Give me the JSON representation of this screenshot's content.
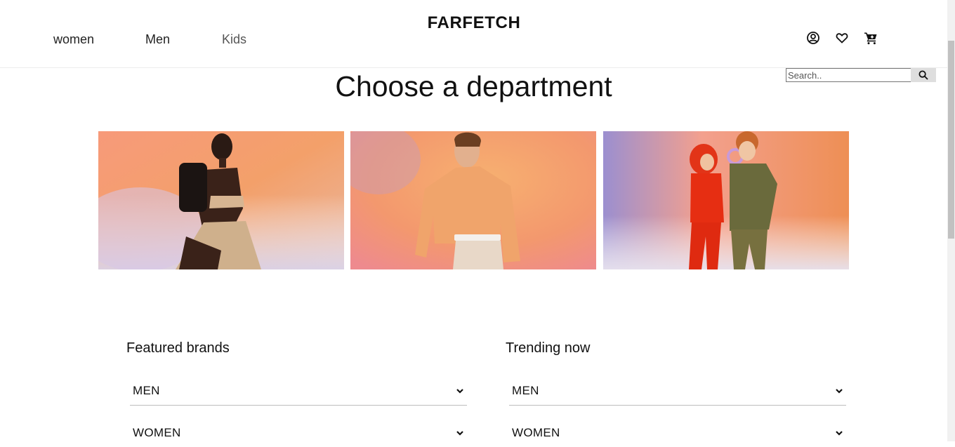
{
  "header": {
    "logo": "FARFETCH",
    "nav": [
      {
        "label": "women"
      },
      {
        "label": "Men"
      },
      {
        "label": "Kids"
      }
    ],
    "icons": [
      "account-icon",
      "heart-icon",
      "cart-icon"
    ]
  },
  "search": {
    "placeholder": "Search..",
    "value": "",
    "button_icon": "search-icon"
  },
  "main": {
    "title": "Choose a department",
    "departments": [
      "women",
      "men",
      "kids"
    ]
  },
  "sections": [
    {
      "title": "Featured brands",
      "items": [
        {
          "label": "MEN"
        },
        {
          "label": "WOMEN"
        }
      ]
    },
    {
      "title": "Trending now",
      "items": [
        {
          "label": "MEN"
        },
        {
          "label": "WOMEN"
        }
      ]
    }
  ],
  "colors": {
    "accent_orange": "#f3985a",
    "border": "#bdbdbd"
  }
}
